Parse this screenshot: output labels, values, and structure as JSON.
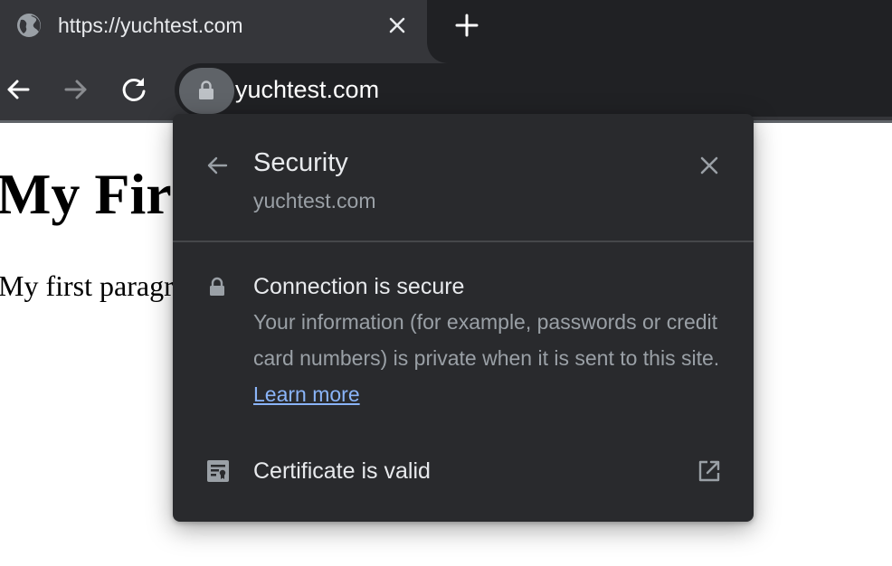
{
  "browser": {
    "tab": {
      "title": "https://yuchtest.com",
      "favicon": "globe-icon"
    },
    "new_tab_icon": "plus-icon",
    "toolbar": {
      "back_icon": "arrow-left-icon",
      "forward_icon": "arrow-right-icon",
      "reload_icon": "reload-icon",
      "site_info_icon": "lock-icon",
      "url": "yuchtest.com"
    }
  },
  "page": {
    "heading": "My First Heading",
    "paragraph": "My first paragraph."
  },
  "security_popup": {
    "title": "Security",
    "subtitle": "yuchtest.com",
    "connection": {
      "title": "Connection is secure",
      "description": "Your information (for example, passwords or credit card numbers) is private when it is sent to this site.",
      "link": "Learn more"
    },
    "certificate": {
      "label": "Certificate is valid",
      "icon": "certificate-icon",
      "action_icon": "external-link-icon"
    }
  },
  "colors": {
    "tabstrip_bg": "#202124",
    "toolbar_bg": "#35363a",
    "popup_bg": "#292a2d",
    "primary_text": "#e8eaed",
    "secondary_text": "#9aa0a6",
    "link": "#8ab4f8"
  }
}
